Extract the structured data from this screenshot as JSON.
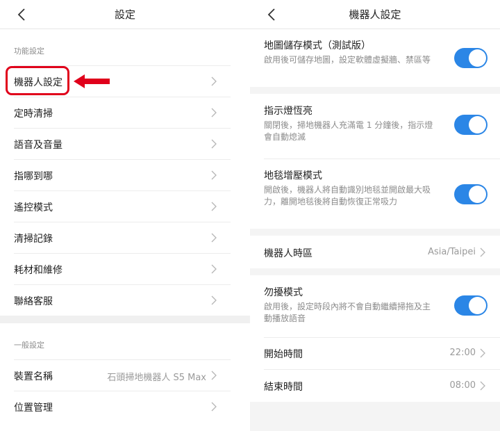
{
  "left": {
    "title": "設定",
    "section_function": "功能設定",
    "function_items": [
      {
        "label": "機器人設定"
      },
      {
        "label": "定時清掃"
      },
      {
        "label": "語音及音量"
      },
      {
        "label": "指哪到哪"
      },
      {
        "label": "遙控模式"
      },
      {
        "label": "清掃記錄"
      },
      {
        "label": "耗材和維修"
      },
      {
        "label": "聯絡客服"
      }
    ],
    "section_general": "一般設定",
    "general_items": [
      {
        "label": "裝置名稱",
        "value": "石頭掃地機器人 S5 Max"
      },
      {
        "label": "位置管理"
      }
    ]
  },
  "right": {
    "title": "機器人設定",
    "map_save": {
      "title": "地圖儲存模式（測試版）",
      "desc": "啟用後可儲存地圖，設定軟體虛擬牆、禁區等",
      "on": true
    },
    "indicator": {
      "title": "指示燈恆亮",
      "desc": "關閉後，掃地機器人充滿電 1 分鐘後，指示燈會自動熄滅",
      "on": true
    },
    "carpet": {
      "title": "地毯增壓模式",
      "desc": "開啟後，機器人將自動識別地毯並開啟最大吸力，離開地毯後將自動恢復正常吸力",
      "on": true
    },
    "timezone": {
      "title": "機器人時區",
      "value": "Asia/Taipei"
    },
    "dnd": {
      "title": "勿擾模式",
      "desc": "啟用後，設定時段內將不會自動繼續掃拖及主動播放語音",
      "on": true
    },
    "start_time": {
      "title": "開始時間",
      "value": "22:00"
    },
    "end_time": {
      "title": "結束時間",
      "value": "08:00"
    }
  },
  "colors": {
    "accent": "#2b86e6",
    "highlight": "#e0001b"
  }
}
